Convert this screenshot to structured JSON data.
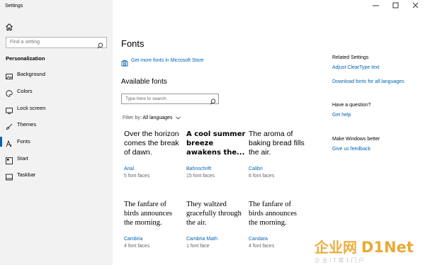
{
  "window": {
    "title": "Settings"
  },
  "sidebar": {
    "search_placeholder": "Find a setting",
    "section_title": "Personalization",
    "items": [
      {
        "label": "Background",
        "icon": "image-icon"
      },
      {
        "label": "Colors",
        "icon": "palette-icon"
      },
      {
        "label": "Lock screen",
        "icon": "lock-screen-icon"
      },
      {
        "label": "Themes",
        "icon": "brush-icon"
      },
      {
        "label": "Fonts",
        "icon": "font-icon",
        "active": true
      },
      {
        "label": "Start",
        "icon": "start-icon"
      },
      {
        "label": "Taskbar",
        "icon": "taskbar-icon"
      }
    ]
  },
  "main": {
    "title": "Fonts",
    "store_link": "Get more fonts in Microsoft Store",
    "available_title": "Available fonts",
    "search_placeholder": "Type here to search.",
    "filter_label": "Filter by:",
    "filter_value": "All languages",
    "fonts": [
      {
        "sample": "Over the horizon comes the break of dawn.",
        "name": "Arial",
        "faces": "5 font faces"
      },
      {
        "sample": "A cool summer breeze awakens the...",
        "name": "Bahnschrift",
        "faces": "15 font faces"
      },
      {
        "sample": "The aroma of baking bread fills the air.",
        "name": "Calibri",
        "faces": "6 font faces"
      },
      {
        "sample": "The fanfare of birds announces the morning.",
        "name": "Cambria",
        "faces": "4 font faces"
      },
      {
        "sample": "They waltzed gracefully through the air.",
        "name": "Cambria Math",
        "faces": "1 font face"
      },
      {
        "sample": "The fanfare of birds announces the morning.",
        "name": "Candara",
        "faces": "4 font faces"
      }
    ]
  },
  "related": {
    "settings_title": "Related Settings",
    "cleartype_link": "Adjust ClearType text",
    "download_link": "Download fonts for all languages",
    "question_title": "Have a question?",
    "help_link": "Get help",
    "better_title": "Make Windows better",
    "feedback_link": "Give us feedback"
  },
  "watermark": {
    "brand": "企业网",
    "logo": "D1Net",
    "tagline": "企 业 I T 第 1 门 户"
  },
  "colors": {
    "accent": "#0063b1",
    "sidebar_bg": "#f2f2f2",
    "watermark": "#e8a020"
  }
}
